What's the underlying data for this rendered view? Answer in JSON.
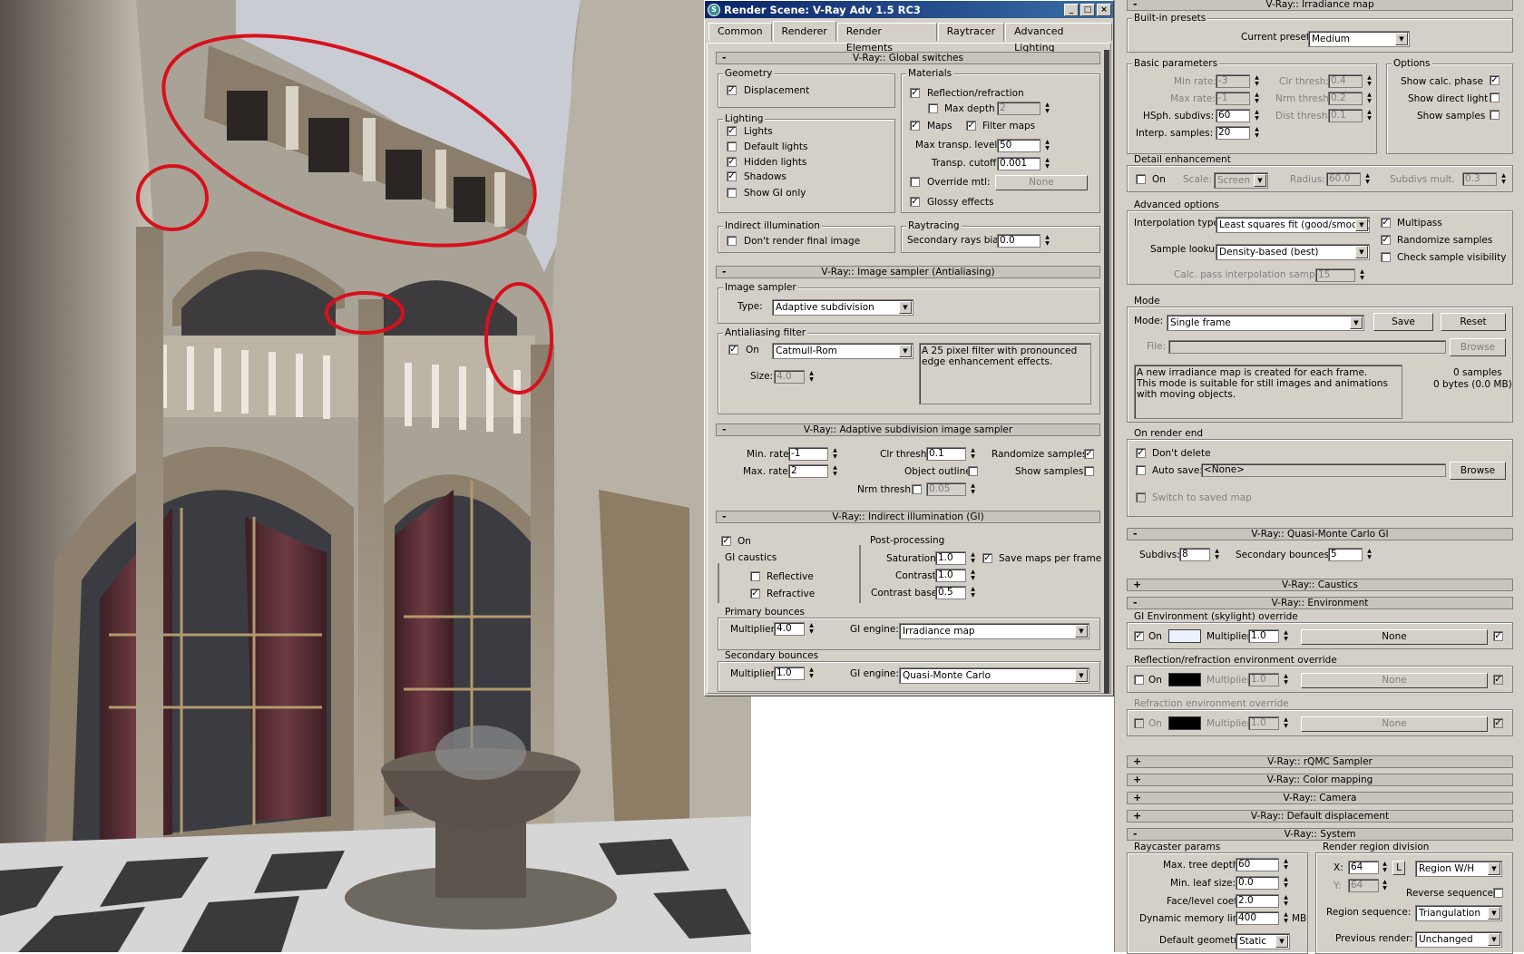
{
  "window": {
    "title": "Render Scene: V-Ray Adv 1.5 RC3",
    "min": "_",
    "max": "□",
    "close": "×"
  },
  "tabs": [
    "Common",
    "Renderer",
    "Render Elements",
    "Raytracer",
    "Advanced Lighting"
  ],
  "check": "✓",
  "arrows": {
    "up": "▲",
    "down": "▼"
  },
  "global": {
    "header": "V-Ray:: Global switches",
    "geometry": "Geometry",
    "displacement": "Displacement",
    "lighting": "Lighting",
    "lights": "Lights",
    "default_lights": "Default lights",
    "hidden_lights": "Hidden lights",
    "shadows": "Shadows",
    "show_gi_only": "Show GI only",
    "indirect": "Indirect illumination",
    "dont_render": "Don't render final image",
    "materials": "Materials",
    "reflection": "Reflection/refraction",
    "max_depth": "Max depth",
    "max_depth_val": "2",
    "maps": "Maps",
    "filter_maps": "Filter maps",
    "max_transp": "Max transp. levels",
    "max_transp_val": "50",
    "transp_cutoff": "Transp. cutoff",
    "transp_cutoff_val": "0.001",
    "override_mtl": "Override mtl:",
    "none": "None",
    "glossy": "Glossy effects",
    "raytracing": "Raytracing",
    "secondary_bias": "Secondary rays bias",
    "secondary_bias_val": "0.0"
  },
  "sampler": {
    "header": "V-Ray:: Image sampler (Antialiasing)",
    "group": "Image sampler",
    "type_label": "Type:",
    "type": "Adaptive subdivision",
    "aa_group": "Antialiasing filter",
    "on": "On",
    "filter": "Catmull-Rom",
    "size_label": "Size:",
    "size": "4.0",
    "desc": "A 25 pixel filter with pronounced edge enhancement effects."
  },
  "adaptive": {
    "header": "V-Ray:: Adaptive subdivision image sampler",
    "min_rate": "Min. rate:",
    "min_rate_val": "-1",
    "max_rate": "Max. rate:",
    "max_rate_val": "2",
    "clr_thresh": "Clr thresh:",
    "clr_thresh_val": "0.1",
    "object_outline": "Object outline",
    "nrm_thresh": "Nrm thresh:",
    "nrm_thresh_val": "0.05",
    "randomize": "Randomize samples",
    "show_samples": "Show samples"
  },
  "gi": {
    "header": "V-Ray:: Indirect illumination (GI)",
    "on": "On",
    "caustics": "GI caustics",
    "reflective": "Reflective",
    "refractive": "Refractive",
    "post": "Post-processing",
    "saturation": "Saturation:",
    "saturation_val": "1.0",
    "contrast": "Contrast:",
    "contrast_val": "1.0",
    "contrast_base": "Contrast base:",
    "contrast_base_val": "0.5",
    "save_maps": "Save maps per frame",
    "primary": "Primary bounces",
    "multiplier": "Multiplier:",
    "primary_mult": "4.0",
    "gi_engine": "GI engine:",
    "primary_engine": "Irradiance map",
    "secondary": "Secondary bounces",
    "secondary_mult": "1.0",
    "secondary_engine": "Quasi-Monte Carlo"
  },
  "irr": {
    "header": "V-Ray:: Irradiance map",
    "builtin": "Built-in presets",
    "current_preset": "Current preset:",
    "preset": "Medium",
    "basic": "Basic parameters",
    "min_rate": "Min rate:",
    "min_rate_val": "-3",
    "max_rate": "Max rate:",
    "max_rate_val": "-1",
    "hsph": "HSph. subdivs:",
    "hsph_val": "60",
    "interp": "Interp. samples:",
    "interp_val": "20",
    "clr_thresh": "Clr thresh:",
    "clr_thresh_val": "0.4",
    "nrm_thresh": "Nrm thresh:",
    "nrm_thresh_val": "0.2",
    "dist_thresh": "Dist thresh:",
    "dist_thresh_val": "0.1",
    "options": "Options",
    "show_calc": "Show calc. phase",
    "show_direct": "Show direct light",
    "show_samples": "Show samples",
    "detail": "Detail enhancement",
    "on": "On",
    "scale": "Scale:",
    "scale_val": "Screen",
    "radius": "Radius:",
    "radius_val": "60.0",
    "subdivs_mult": "Subdivs mult.",
    "subdivs_mult_val": "0.3",
    "advanced": "Advanced options",
    "interp_type": "Interpolation type:",
    "interp_type_val": "Least squares fit (good/smooth)",
    "multipass": "Multipass",
    "randomize": "Randomize samples",
    "sample_lookup": "Sample lookup:",
    "sample_lookup_val": "Density-based (best)",
    "check_vis": "Check sample visibility",
    "calc_pass": "Calc. pass interpolation samples:",
    "calc_pass_val": "15",
    "mode": "Mode",
    "mode_label": "Mode:",
    "mode_val": "Single frame",
    "save": "Save",
    "reset": "Reset",
    "file": "File:",
    "browse": "Browse",
    "mode_desc": "A new irradiance map is created for each frame.\nThis mode is suitable for still images and animations with moving objects.",
    "samples": "0 samples",
    "bytes": "0 bytes (0.0 MB)",
    "on_end": "On render end",
    "dont_delete": "Don't delete",
    "auto_save": "Auto save:",
    "auto_save_val": "<None>",
    "switch_saved": "Switch to saved map"
  },
  "qmc": {
    "header": "V-Ray:: Quasi-Monte Carlo GI",
    "subdivs": "Subdivs:",
    "subdivs_val": "8",
    "bounces": "Secondary bounces:",
    "bounces_val": "5"
  },
  "caustics": {
    "header": "V-Ray:: Caustics"
  },
  "env": {
    "header": "V-Ray:: Environment",
    "gi_env": "GI Environment (skylight) override",
    "on": "On",
    "multiplier": "Multiplier:",
    "mult_val": "1.0",
    "none": "None",
    "refl_env": "Reflection/refraction environment override",
    "refr_env": "Refraction environment override"
  },
  "collapsed": [
    "V-Ray:: rQMC Sampler",
    "V-Ray:: Color mapping",
    "V-Ray:: Camera",
    "V-Ray:: Default displacement"
  ],
  "system": {
    "header": "V-Ray:: System",
    "raycaster": "Raycaster params",
    "max_tree": "Max. tree depth:",
    "max_tree_val": "60",
    "min_leaf": "Min. leaf size:",
    "min_leaf_val": "0.0",
    "face_coef": "Face/level coef.",
    "face_coef_val": "2.0",
    "dyn_mem": "Dynamic memory limit:",
    "dyn_mem_val": "400",
    "mb": "MB",
    "default_geom": "Default geometry:",
    "default_geom_val": "Static",
    "region": "Render region division",
    "x": "X:",
    "x_val": "64",
    "y": "Y:",
    "y_val": "64",
    "l": "L",
    "region_wh": "Region W/H",
    "reverse": "Reverse sequence",
    "region_seq": "Region sequence:",
    "region_seq_val": "Triangulation",
    "prev_render": "Previous render:",
    "prev_render_val": "Unchanged"
  },
  "colors": {
    "accent": "#0a246a",
    "annotation": "#d8101c"
  }
}
